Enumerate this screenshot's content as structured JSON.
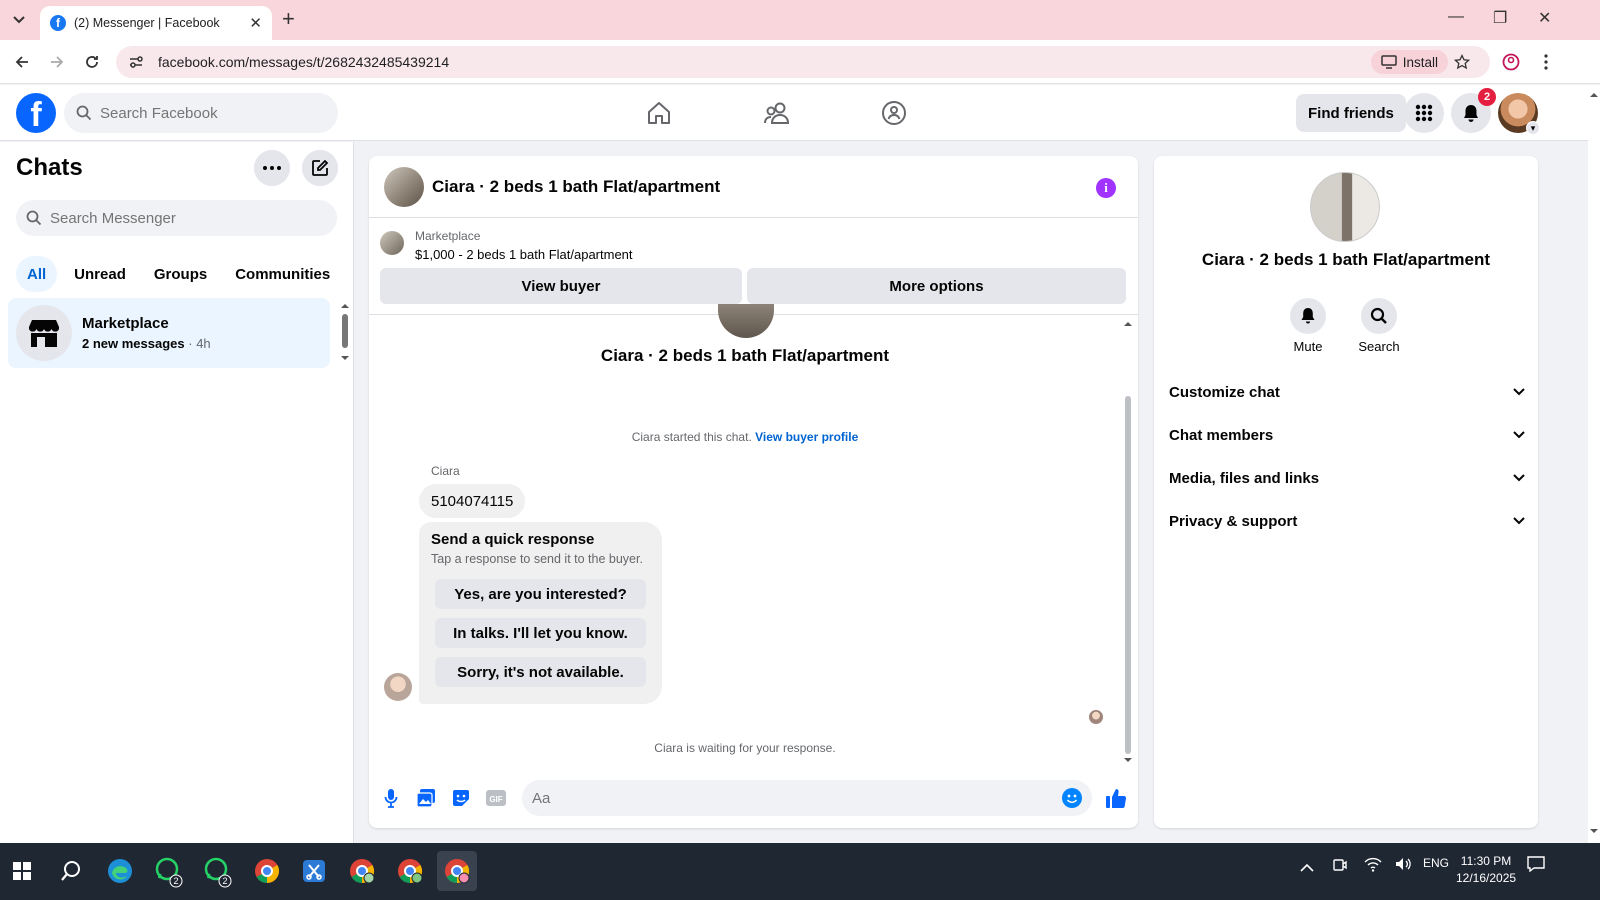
{
  "browser": {
    "tab_title": "(2) Messenger | Facebook",
    "url": "facebook.com/messages/t/2682432485439214",
    "install_label": "Install"
  },
  "fb": {
    "search_placeholder": "Search Facebook",
    "find_friends": "Find friends",
    "notification_count": "2",
    "brand_color": "#0866ff"
  },
  "chats": {
    "title": "Chats",
    "search_placeholder": "Search Messenger",
    "filters": [
      "All",
      "Unread",
      "Groups",
      "Communities"
    ],
    "items": [
      {
        "name": "Marketplace",
        "subtitle": "2 new messages",
        "time": "· 4h"
      }
    ]
  },
  "conversation": {
    "title": "Ciara · 2 beds 1 bath Flat/apartment",
    "marketplace_label": "Marketplace",
    "listing": "$1,000 - 2 beds 1 bath Flat/apartment",
    "view_buyer": "View buyer",
    "more_options": "More options",
    "header_name": "Ciara · 2 beds 1 bath Flat/apartment",
    "started_text": "Ciara started this chat.",
    "started_link": "View buyer profile",
    "sender": "Ciara",
    "message": "5104074115",
    "quick_title": "Send a quick response",
    "quick_subtitle": "Tap a response to send it to the buyer.",
    "quick_replies": [
      "Yes, are you interested?",
      "In talks. I'll let you know.",
      "Sorry, it's not available."
    ],
    "waiting": "Ciara is waiting for your response.",
    "composer_placeholder": "Aa"
  },
  "info_panel": {
    "name": "Ciara · 2 beds 1 bath Flat/apartment",
    "actions": [
      "Mute",
      "Search"
    ],
    "sections": [
      "Customize chat",
      "Chat members",
      "Media, files and links",
      "Privacy & support"
    ]
  },
  "taskbar": {
    "whatsapp_badge_1": "2",
    "whatsapp_badge_2": "2",
    "language": "ENG",
    "time": "11:30 PM",
    "date": "12/16/2025"
  }
}
